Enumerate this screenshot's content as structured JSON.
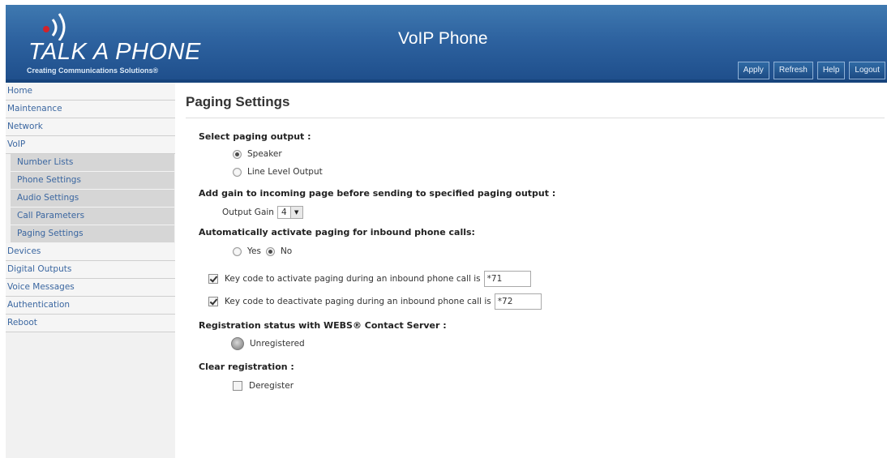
{
  "header": {
    "logo_text": "TALK A PHONE",
    "tagline": "Creating Communications Solutions®",
    "title": "VoIP Phone",
    "buttons": [
      "Apply",
      "Refresh",
      "Help",
      "Logout"
    ]
  },
  "sidebar": {
    "items": [
      {
        "label": "Home"
      },
      {
        "label": "Maintenance"
      },
      {
        "label": "Network"
      },
      {
        "label": "VoIP"
      },
      {
        "label": "Number Lists",
        "sub": true
      },
      {
        "label": "Phone Settings",
        "sub": true
      },
      {
        "label": "Audio Settings",
        "sub": true
      },
      {
        "label": "Call Parameters",
        "sub": true
      },
      {
        "label": "Paging Settings",
        "sub": true,
        "active": true
      },
      {
        "label": "Devices"
      },
      {
        "label": "Digital Outputs"
      },
      {
        "label": "Voice Messages"
      },
      {
        "label": "Authentication"
      },
      {
        "label": "Reboot"
      }
    ]
  },
  "page": {
    "title": "Paging Settings",
    "output_heading": "Select paging output :",
    "output_speaker": "Speaker",
    "output_line": "Line Level Output",
    "output_selected": "Speaker",
    "gain_heading": "Add gain to incoming page before sending to specified paging output :",
    "gain_label": "Output Gain",
    "gain_value": "4",
    "auto_heading": "Automatically activate paging for inbound phone calls:",
    "auto_yes": "Yes",
    "auto_no": "No",
    "auto_selected": "No",
    "activate_label": "Key code to activate paging during an inbound phone call is",
    "activate_value": "*71",
    "activate_checked": true,
    "deactivate_label": "Key code to deactivate paging during an inbound phone call is",
    "deactivate_value": "*72",
    "deactivate_checked": true,
    "reg_heading": "Registration status with WEBS® Contact Server :",
    "reg_status": "Unregistered",
    "clear_heading": "Clear registration :",
    "deregister_label": "Deregister",
    "deregister_checked": false
  },
  "colors": {
    "header_blue": "#2e63a0",
    "nav_link": "#3a66a0",
    "logo_dot": "#d2232a"
  }
}
